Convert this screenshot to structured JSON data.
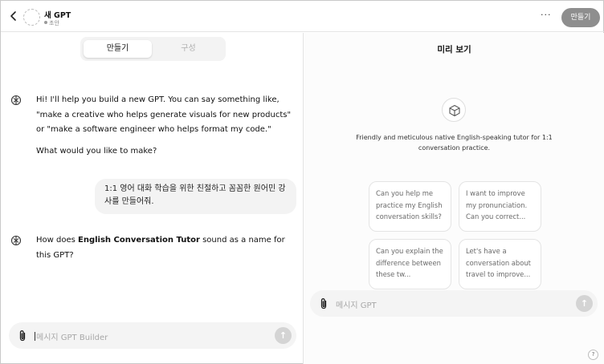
{
  "header": {
    "back_icon": "chevron-left-icon",
    "title": "새 GPT",
    "status": "초안",
    "more": "···",
    "create_button": "만들기"
  },
  "builder": {
    "tabs": [
      {
        "label": "만들기",
        "active": true
      },
      {
        "label": "구성",
        "active": false
      }
    ],
    "messages": [
      {
        "role": "assistant",
        "paragraphs": [
          "Hi! I'll help you build a new GPT. You can say something like, \"make a creative who helps generate visuals for new products\" or \"make a software engineer who helps format my code.\"",
          "What would you like to make?"
        ]
      },
      {
        "role": "user",
        "text": "1:1 영어 대화 학습을 위한 친절하고 꼼꼼한 원어민 강사를 만들어줘."
      },
      {
        "role": "assistant",
        "pre": "How does ",
        "bold": "English Conversation Tutor",
        "post": " sound as a name for this GPT?"
      }
    ],
    "input_placeholder": "메시지 GPT Builder"
  },
  "preview": {
    "title": "미리 보기",
    "description": "Friendly and meticulous native English-speaking tutor for 1:1 conversation practice.",
    "starters": [
      "Can you help me practice my English conversation skills?",
      "I want to improve my pronunciation. Can you correct...",
      "Can you explain the difference between these tw...",
      "Let's have a conversation about travel to improve..."
    ],
    "input_placeholder": "메시지 GPT",
    "help": "?"
  },
  "colors": {
    "send_disabled": "#d4d4d4",
    "create_button_bg": "#8e8e8e",
    "input_bg": "#f4f4f4"
  }
}
